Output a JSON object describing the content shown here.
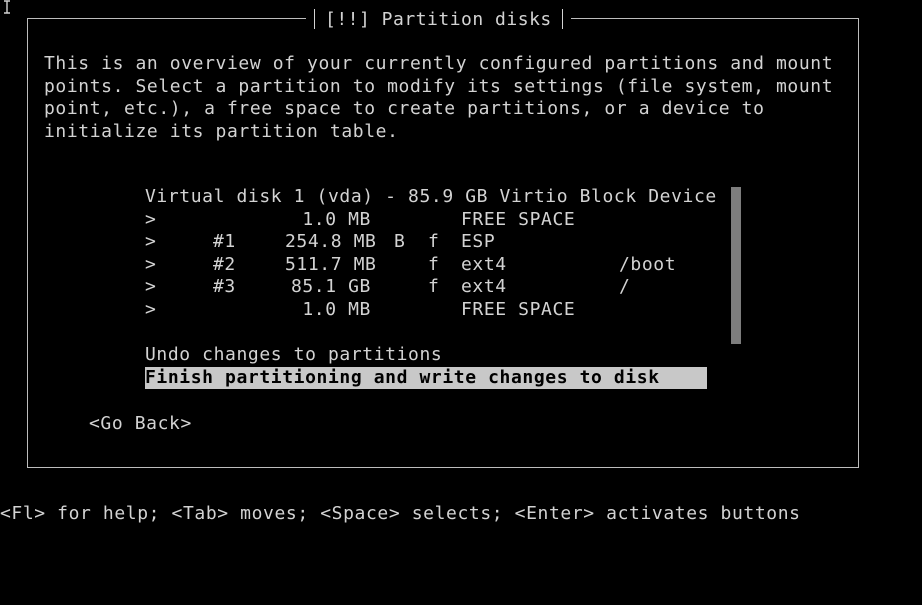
{
  "dialog": {
    "title": "[!!] Partition disks",
    "description": "This is an overview of your currently configured partitions and mount points. Select a partition to modify its settings (file system, mount point, etc.), a free space to create partitions, or a device to initialize its partition table."
  },
  "disk": {
    "label": "Virtual disk 1 (vda) - 85.9 GB Virtio Block Device"
  },
  "partitions": [
    {
      "marker": ">",
      "number": "",
      "size": "1.0 MB",
      "boot": "",
      "format": "",
      "fs": "FREE SPACE",
      "mount": ""
    },
    {
      "marker": ">",
      "number": "#1",
      "size": "254.8 MB",
      "boot": "B",
      "format": "f",
      "fs": "ESP",
      "mount": ""
    },
    {
      "marker": ">",
      "number": "#2",
      "size": "511.7 MB",
      "boot": "",
      "format": "f",
      "fs": "ext4",
      "mount": "/boot"
    },
    {
      "marker": ">",
      "number": "#3",
      "size": "85.1 GB",
      "boot": "",
      "format": "f",
      "fs": "ext4",
      "mount": "/"
    },
    {
      "marker": ">",
      "number": "",
      "size": "1.0 MB",
      "boot": "",
      "format": "",
      "fs": "FREE SPACE",
      "mount": ""
    }
  ],
  "actions": {
    "undo": "Undo changes to partitions",
    "finish": "Finish partitioning and write changes to disk"
  },
  "buttons": {
    "go_back": "<Go Back>"
  },
  "helpbar": {
    "text": "<Fl> for help; <Tab> moves; <Space> selects; <Enter> activates buttons"
  },
  "colors": {
    "background": "#000000",
    "text": "#d3d3d3",
    "highlight": "#c8c8c8",
    "scrollbar": "#7d7d7d"
  },
  "icons": {
    "cursor": "text-cursor-icon"
  }
}
